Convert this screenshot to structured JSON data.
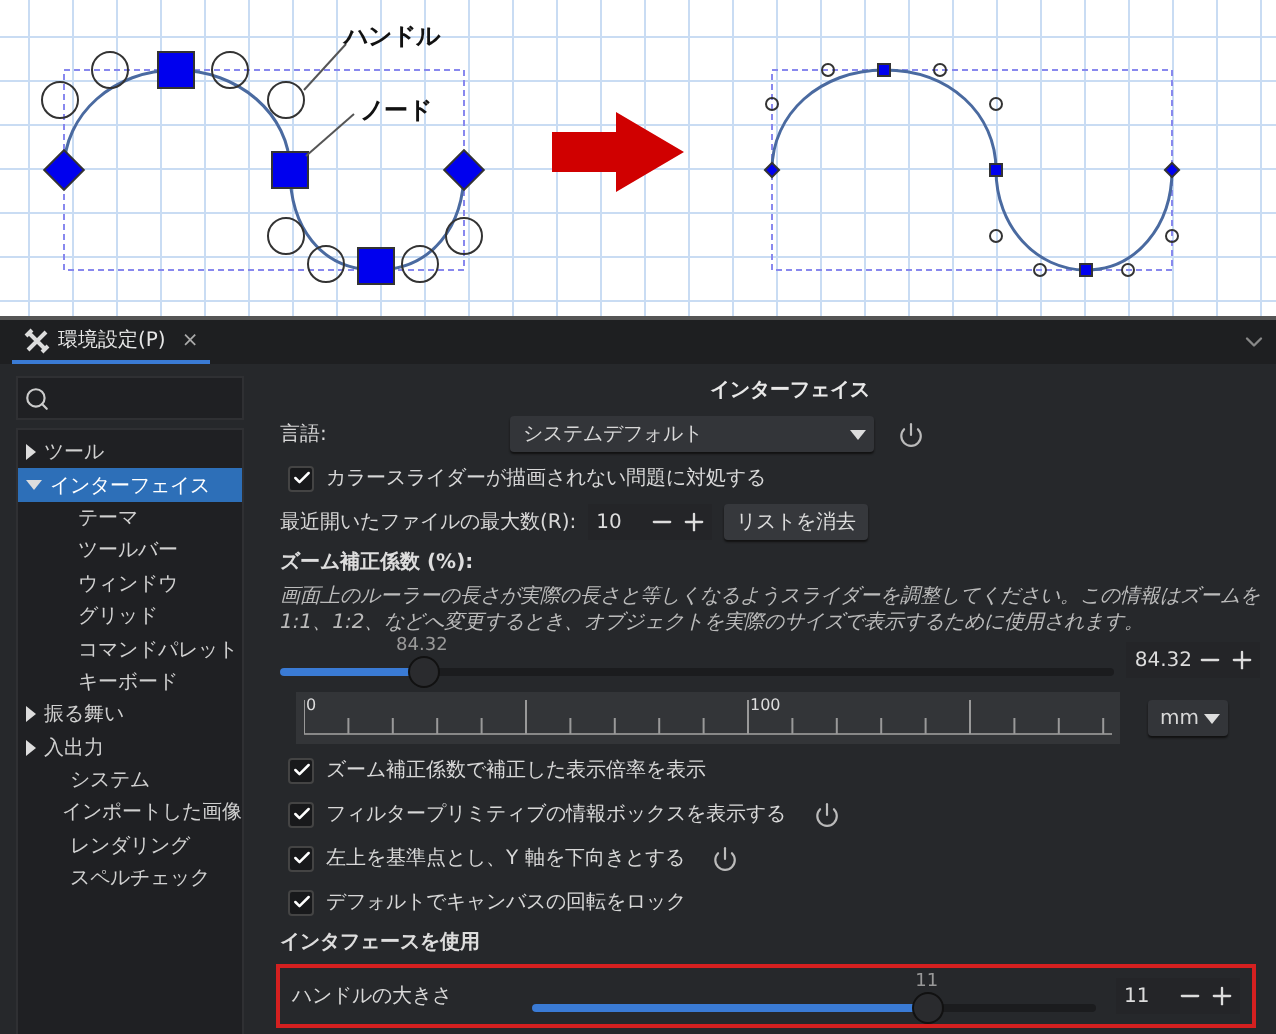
{
  "diagram": {
    "labels": [
      "ハンドル",
      "ノード"
    ]
  },
  "tab": {
    "title": "環境設定(P)",
    "close": "×"
  },
  "sidebar": {
    "items": [
      {
        "label": "ツール",
        "kind": "folder",
        "expanded": false,
        "selected": false
      },
      {
        "label": "インターフェイス",
        "kind": "folder",
        "expanded": true,
        "selected": true,
        "children": [
          {
            "label": "テーマ",
            "selected": false
          },
          {
            "label": "ツールバー",
            "selected": false
          },
          {
            "label": "ウィンドウ",
            "selected": false
          },
          {
            "label": "グリッド",
            "selected": false
          },
          {
            "label": "コマンドパレット",
            "selected": false
          },
          {
            "label": "キーボード",
            "selected": false
          }
        ]
      },
      {
        "label": "振る舞い",
        "kind": "folder",
        "expanded": false,
        "selected": false
      },
      {
        "label": "入出力",
        "kind": "folder",
        "expanded": false,
        "selected": false
      },
      {
        "label": "システム",
        "kind": "page",
        "selected": false
      },
      {
        "label": "インポートした画像",
        "kind": "page",
        "selected": false
      },
      {
        "label": "レンダリング",
        "kind": "page",
        "selected": false
      },
      {
        "label": "スペルチェック",
        "kind": "page",
        "selected": false
      }
    ]
  },
  "main": {
    "heading": "インターフェイス",
    "language": {
      "label": "言語:",
      "value": "システムデフォルト"
    },
    "fix_checkbox": {
      "label": "カラースライダーが描画されない問題に対処する",
      "checked": true
    },
    "recent": {
      "label": "最近開いたファイルの最大数(R):",
      "value": "10",
      "button": "リストを消去"
    },
    "zoom": {
      "title": "ズーム補正係数 (%):",
      "description": "画面上のルーラーの長さが実際の長さと等しくなるようスライダーを調整してください。この情報はズームを 1:1、1:2、などへ変更するとき、オブジェクトを実際のサイズで表示するために使用されます。",
      "level": 0.17,
      "slider_value": "84.32",
      "spin_value": "84.32",
      "ruler_labels": [
        "0",
        "100"
      ],
      "unit": "mm"
    },
    "checkboxes": [
      {
        "label": "ズーム補正係数で補正した表示倍率を表示",
        "checked": true,
        "restart": false
      },
      {
        "label": "フィルタープリミティブの情報ボックスを表示する",
        "checked": true,
        "restart": true
      },
      {
        "label": "左上を基準点とし、Y 軸を下向きとする",
        "checked": true,
        "restart": true
      },
      {
        "label": "デフォルトでキャンバスの回転をロック",
        "checked": true,
        "restart": false
      }
    ],
    "section": "インタフェースを使用",
    "handle": {
      "label": "ハンドルの大きさ",
      "level": 0.7,
      "slider_value": "11",
      "spin_value": "11",
      "highlighted": true
    }
  }
}
